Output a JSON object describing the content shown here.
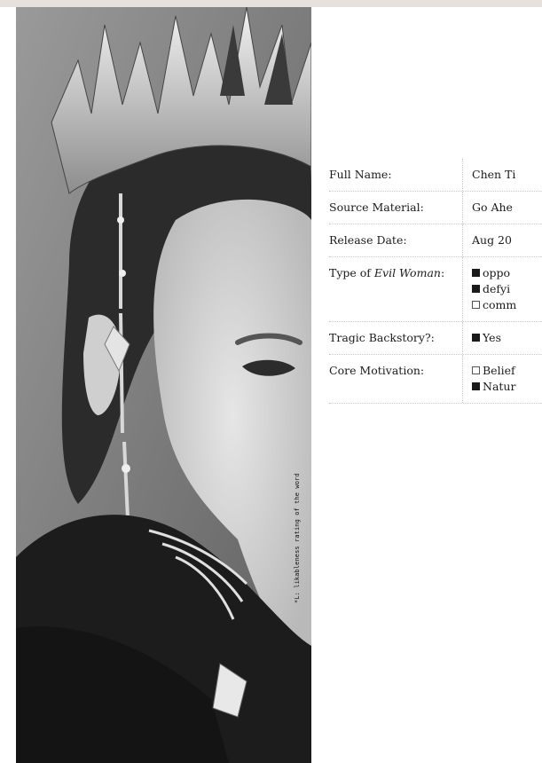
{
  "side_note": "*L: likableness rating of the word",
  "profile": {
    "rows": [
      {
        "key": "full_name",
        "label": "Full Name:",
        "value": "Chen Ti"
      },
      {
        "key": "source_material",
        "label": "Source Material:",
        "value": "Go Ahe"
      },
      {
        "key": "release_date",
        "label": "Release Date:",
        "value": "Aug 20"
      },
      {
        "key": "type",
        "label_prefix": "Type of ",
        "label_italic": "Evil Woman",
        "label_suffix": ":",
        "options": [
          {
            "text": "oppo",
            "checked": true
          },
          {
            "text": "defyi",
            "checked": true
          },
          {
            "text": "comm",
            "checked": false
          }
        ]
      },
      {
        "key": "backstory",
        "label": "Tragic Backstory?:",
        "options": [
          {
            "text": "Yes",
            "checked": true
          }
        ]
      },
      {
        "key": "motivation",
        "label": "Core Motivation:",
        "options": [
          {
            "text": "Belief",
            "checked": false
          },
          {
            "text": "Natur",
            "checked": true
          }
        ]
      }
    ]
  }
}
